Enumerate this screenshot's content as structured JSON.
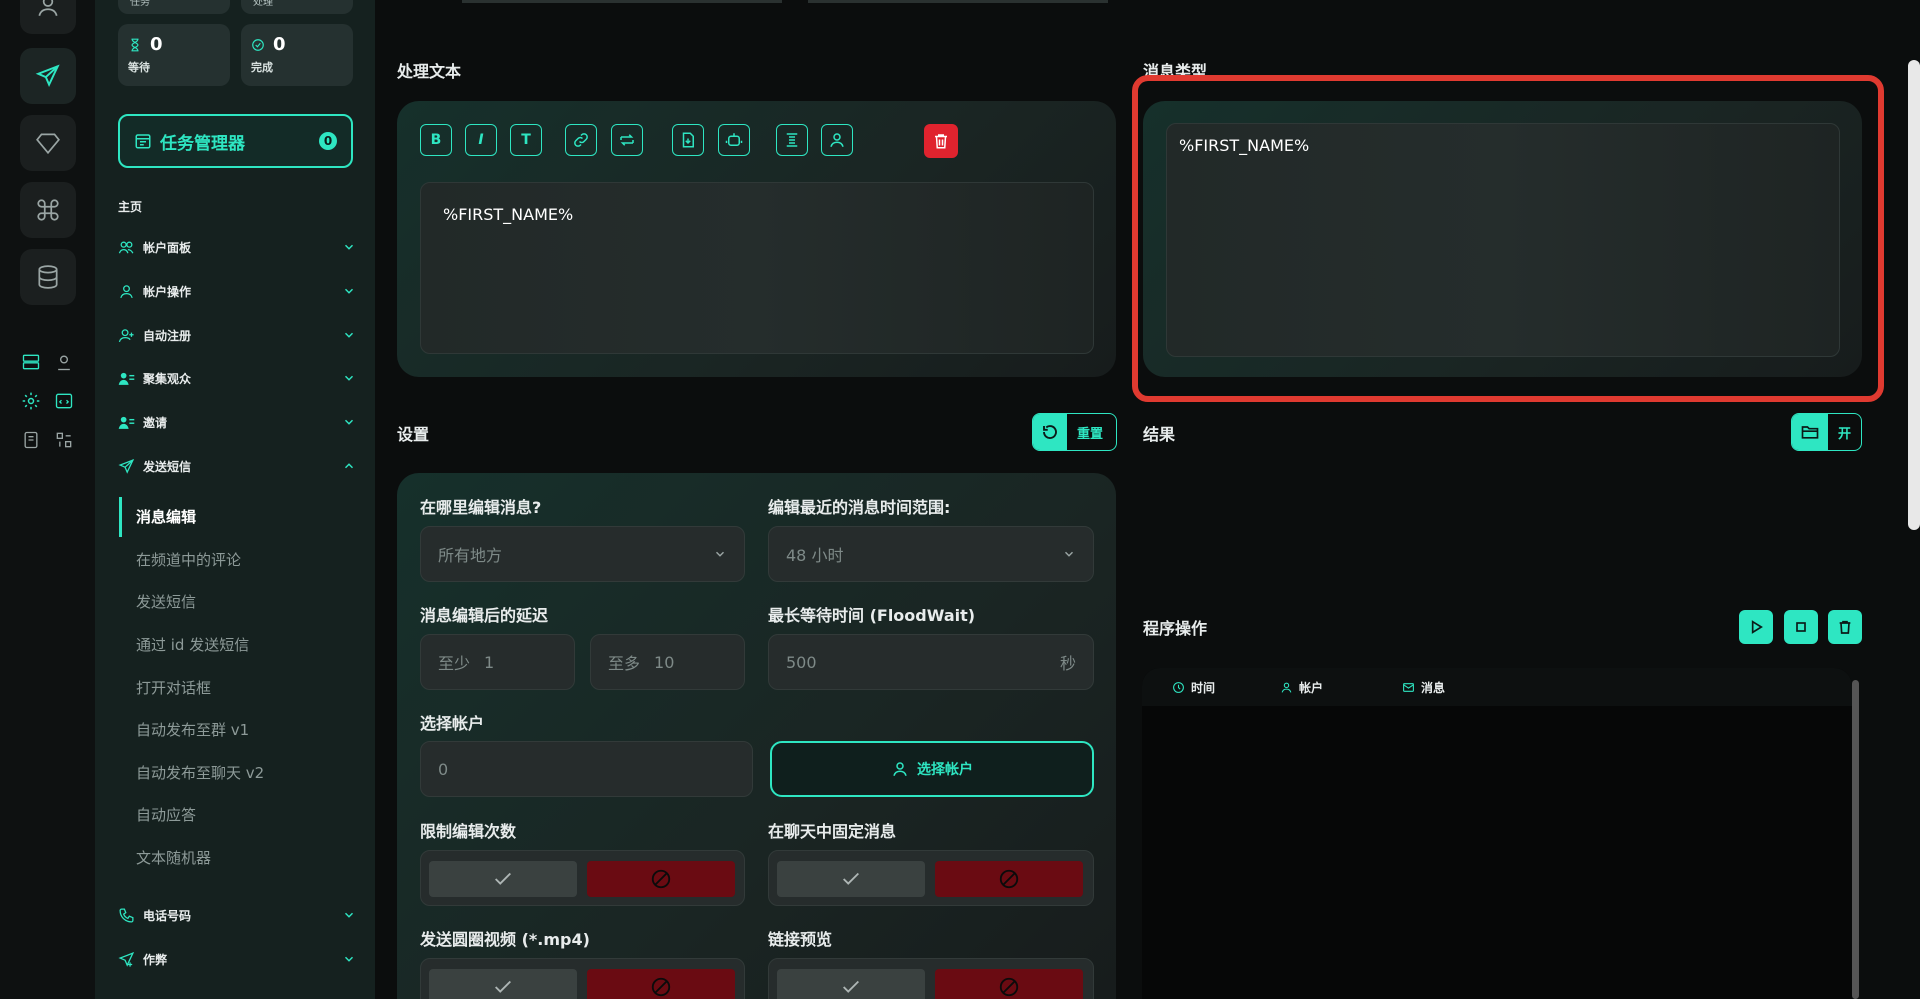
{
  "sidebar": {
    "stats_top": [
      {
        "label": "任务"
      },
      {
        "label": "处理"
      }
    ],
    "stats": [
      {
        "value": "0",
        "label": "等待",
        "icon": "hourglass-icon"
      },
      {
        "value": "0",
        "label": "完成",
        "icon": "check-circle-icon"
      }
    ],
    "task_manager": {
      "label": "任务管理器",
      "badge": "0"
    },
    "section_title": "主页",
    "menu": [
      {
        "label": "帐户面板",
        "icon": "users-icon"
      },
      {
        "label": "帐户操作",
        "icon": "user-icon"
      },
      {
        "label": "自动注册",
        "icon": "user-plus-icon"
      },
      {
        "label": "聚集观众",
        "icon": "users-list-icon"
      },
      {
        "label": "邀请",
        "icon": "users-list-icon"
      },
      {
        "label": "发送短信",
        "icon": "send-icon"
      }
    ],
    "sub_items": [
      "消息编辑",
      "在频道中的评论",
      "发送短信",
      "通过 id 发送短信",
      "打开对话框",
      "自动发布至群 v1",
      "自动发布至聊天 v2",
      "自动应答",
      "文本随机器"
    ],
    "menu_bottom": [
      {
        "label": "电话号码",
        "icon": "phone-icon"
      },
      {
        "label": "作弊",
        "icon": "send-plus-icon"
      }
    ]
  },
  "main": {
    "process_text": {
      "label": "处理文本",
      "toolbar": [
        "B",
        "I",
        "T"
      ],
      "text": "%FIRST_NAME%"
    },
    "message_type": {
      "label": "消息类型",
      "text": "%FIRST_NAME%"
    },
    "settings": {
      "label": "设置",
      "reset_label": "重置",
      "where_label": "在哪里编辑消息?",
      "where_value": "所有地方",
      "range_label": "编辑最近的消息时间范围:",
      "range_value": "48 小时",
      "delay_label": "消息编辑后的延迟",
      "delay_min_prefix": "至少",
      "delay_min": "1",
      "delay_max_prefix": "至多",
      "delay_max": "10",
      "floodwait_label": "最长等待时间 (FloodWait)",
      "floodwait_value": "500",
      "floodwait_unit": "秒",
      "accounts_label": "选择帐户",
      "accounts_value": "0",
      "select_accounts": "选择帐户",
      "limit_label": "限制编辑次数",
      "pin_label": "在聊天中固定消息",
      "video_label": "发送圆圈视频 (*.mp4)",
      "preview_label": "链接预览"
    },
    "results": {
      "label": "结果",
      "open_label": "开"
    },
    "operations": {
      "label": "程序操作",
      "columns": [
        {
          "label": "时间",
          "icon": "clock-icon"
        },
        {
          "label": "帐户",
          "icon": "user-icon"
        },
        {
          "label": "消息",
          "icon": "mail-icon"
        }
      ]
    }
  },
  "colors": {
    "accent": "#2ee6c2",
    "danger": "#e0232e",
    "highlight": "#e03a30"
  }
}
